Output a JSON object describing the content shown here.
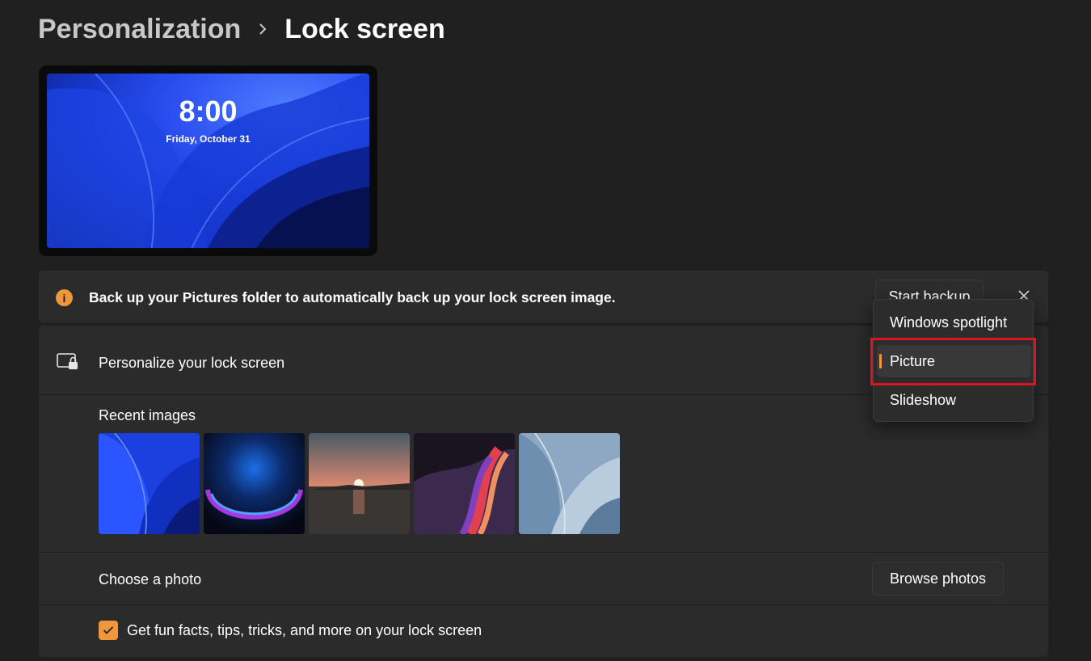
{
  "breadcrumb": {
    "parent": "Personalization",
    "current": "Lock screen"
  },
  "preview": {
    "time": "8:00",
    "date": "Friday, October 31"
  },
  "banner": {
    "icon": "info-icon",
    "icon_glyph": "i",
    "message": "Back up your Pictures folder to automatically back up your lock screen image.",
    "button_label": "Start backup",
    "close_icon": "close-icon"
  },
  "personalize": {
    "icon": "lock-screen-icon",
    "label": "Personalize your lock screen"
  },
  "dropdown": {
    "options": [
      "Windows spotlight",
      "Picture",
      "Slideshow"
    ],
    "selected": "Picture"
  },
  "recent": {
    "label": "Recent images",
    "images": [
      "bloom-blue",
      "glow-orb",
      "sunset-lake",
      "ribbon-swirl",
      "bloom-light"
    ]
  },
  "choose": {
    "label": "Choose a photo",
    "button_label": "Browse photos"
  },
  "tips": {
    "label": "Get fun facts, tips, tricks, and more on your lock screen",
    "checked": true
  },
  "colors": {
    "background": "#202020",
    "card": "#2b2b2b",
    "accent": "#f0973b",
    "highlight": "#e0141e"
  }
}
